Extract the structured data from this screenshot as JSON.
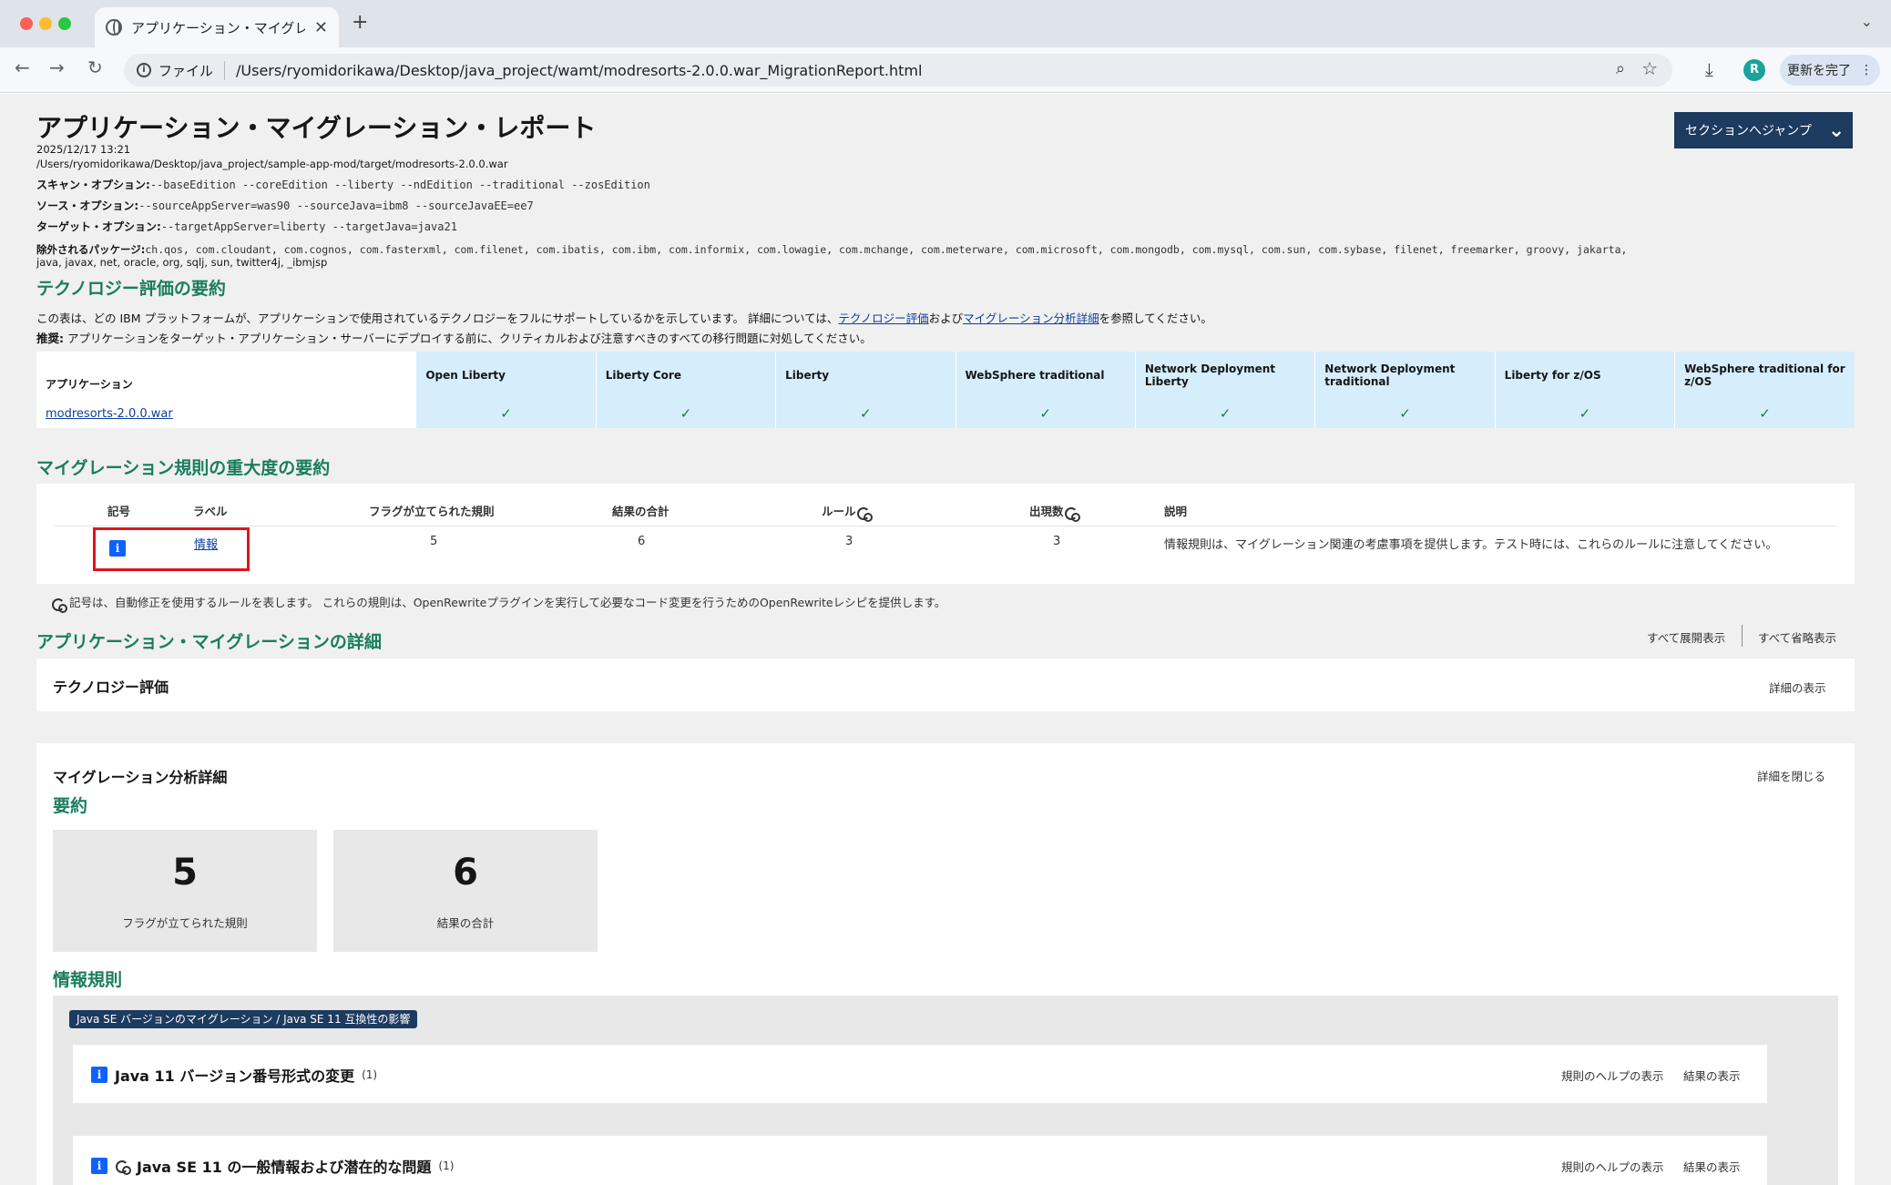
{
  "browser": {
    "tab_title": "アプリケーション・マイグレーシ",
    "tab_close": "✕",
    "new_tab": "+",
    "tab_menu": "⌄",
    "protocol_label": "ファイル",
    "url": "/Users/ryomidorikawa/Desktop/java_project/wamt/modresorts-2.0.0.war_MigrationReport.html",
    "avatar_letter": "R",
    "update_label": "更新を完了"
  },
  "report": {
    "title": "アプリケーション・マイグレーション・レポート",
    "jump_label": "セクションへジャンプ",
    "date": "2025/12/17 13:21",
    "path": "/Users/ryomidorikawa/Desktop/java_project/sample-app-mod/target/modresorts-2.0.0.war",
    "scan_label": "スキャン・オプション:",
    "scan_value": "--baseEdition --coreEdition --liberty --ndEdition --traditional --zosEdition",
    "source_label": "ソース・オプション:",
    "source_value": "--sourceAppServer=was90 --sourceJava=ibm8 --sourceJavaEE=ee7",
    "target_label": "ターゲット・オプション:",
    "target_value": "--targetAppServer=liberty --targetJava=java21",
    "excluded_label": "除外されるパッケージ:",
    "excluded_value_1": "ch.qos, com.cloudant, com.cognos, com.fasterxml, com.filenet, com.ibatis, com.ibm, com.informix, com.lowagie, com.mchange, com.meterware, com.microsoft, com.mongodb, com.mysql, com.sun, com.sybase, filenet, freemarker, groovy, jakarta,",
    "excluded_value_2": "java, javax, net, oracle, org, sqlj, sun, twitter4j, _ibmjsp"
  },
  "tech_summary": {
    "title": "テクノロジー評価の要約",
    "desc_prefix": "この表は、どの IBM プラットフォームが、アプリケーションで使用されているテクノロジーをフルにサポートしているかを示しています。 詳細については、",
    "desc_link1": "テクノロジー評価",
    "desc_mid": "および",
    "desc_link2": "マイグレーション分析詳細",
    "desc_suffix": "を参照してください。",
    "rec_label": "推奨:",
    "rec_text": " アプリケーションをターゲット・アプリケーション・サーバーにデプロイする前に、クリティカルおよび注意すべきのすべての移行問題に対処してください。",
    "app_header": "アプリケーション",
    "platforms": [
      "Open Liberty",
      "Liberty Core",
      "Liberty",
      "WebSphere traditional",
      "Network Deployment Liberty",
      "Network Deployment traditional",
      "Liberty for z/OS",
      "WebSphere traditional for z/OS"
    ],
    "app_name": "modresorts-2.0.0.war",
    "check": "✓"
  },
  "severity": {
    "title": "マイグレーション規則の重大度の要約",
    "headers": {
      "symbol": "記号",
      "label": "ラベル",
      "flagged": "フラグが立てられた規則",
      "total": "結果の合計",
      "rules": "ルール",
      "occurrences": "出現数",
      "desc": "説明"
    },
    "row": {
      "icon": "i",
      "label": "情報",
      "flagged": "5",
      "total": "6",
      "rules": "3",
      "occurrences": "3",
      "desc": "情報規則は、マイグレーション関連の考慮事項を提供します。テスト時には、これらのルールに注意してください。"
    },
    "note": "記号は、自動修正を使用するルールを表します。 これらの規則は、OpenRewriteプラグインを実行して必要なコード変更を行うためのOpenRewriteレシピを提供します。"
  },
  "details": {
    "title": "アプリケーション・マイグレーションの詳細",
    "expand_all": "すべて展開表示",
    "collapse_all": "すべて省略表示",
    "tech_eval_title": "テクノロジー評価",
    "show_details": "詳細の表示",
    "migration_title": "マイグレーション分析詳細",
    "close_details": "詳細を閉じる",
    "summary_title": "要約",
    "tiles": [
      {
        "value": "5",
        "label": "フラグが立てられた規則"
      },
      {
        "value": "6",
        "label": "結果の合計"
      }
    ],
    "info_rules_title": "情報規則",
    "tag": "Java SE バージョンのマイグレーション / Java SE 11 互換性の影響",
    "rules": [
      {
        "title": "Java 11 バージョン番号形式の変更",
        "count": "(1)",
        "help": "規則のヘルプの表示",
        "results": "結果の表示"
      },
      {
        "title": "Java SE 11 の一般情報および潜在的な問題",
        "count": "(1)",
        "help": "規則のヘルプの表示",
        "results": "結果の表示"
      }
    ]
  }
}
